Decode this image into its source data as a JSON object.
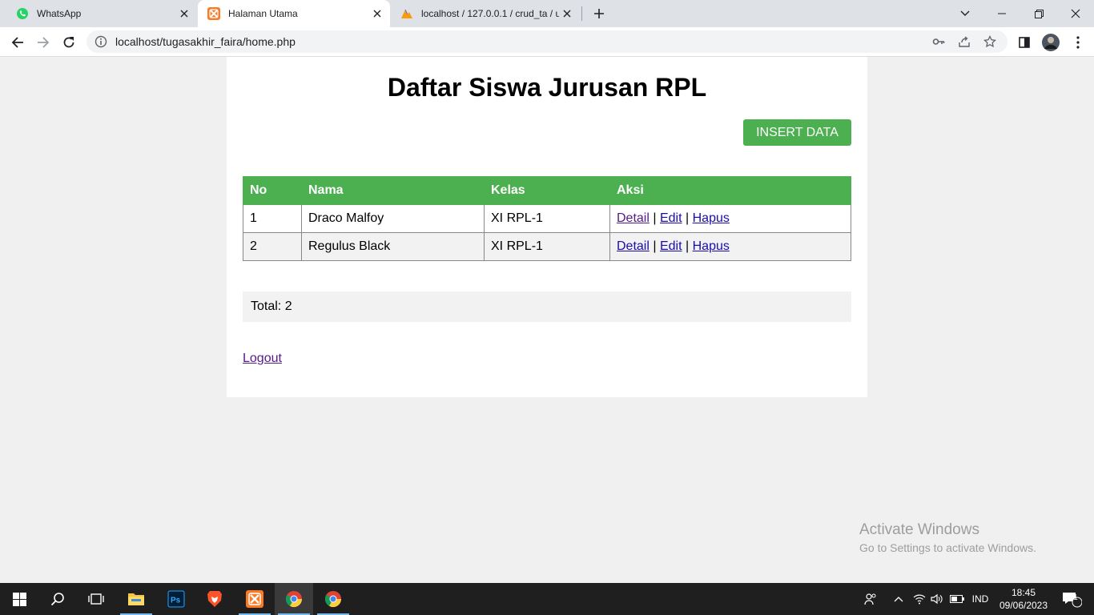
{
  "browser": {
    "tabs": [
      {
        "title": "WhatsApp",
        "favicon": "whatsapp-icon",
        "active": false
      },
      {
        "title": "Halaman Utama",
        "favicon": "xampp-icon",
        "active": true
      },
      {
        "title": "localhost / 127.0.0.1 / crud_ta / u",
        "favicon": "phpmyadmin-icon",
        "active": false
      }
    ],
    "url": "localhost/tugasakhir_faira/home.php"
  },
  "page": {
    "title": "Daftar Siswa Jurusan RPL",
    "insert_label": "INSERT DATA",
    "columns": [
      "No",
      "Nama",
      "Kelas",
      "Aksi"
    ],
    "rows": [
      {
        "no": "1",
        "nama": "Draco Malfoy",
        "kelas": "XI RPL-1"
      },
      {
        "no": "2",
        "nama": "Regulus Black",
        "kelas": "XI RPL-1"
      }
    ],
    "actions": {
      "detail": "Detail",
      "edit": "Edit",
      "hapus": "Hapus",
      "sep": "|"
    },
    "total": "Total: 2",
    "logout": "Logout",
    "accent_color": "#4caf50"
  },
  "watermark": {
    "line1": "Activate Windows",
    "line2": "Go to Settings to activate Windows."
  },
  "taskbar": {
    "language": "IND",
    "time": "18:45",
    "date": "09/06/2023",
    "notifications": "1"
  }
}
